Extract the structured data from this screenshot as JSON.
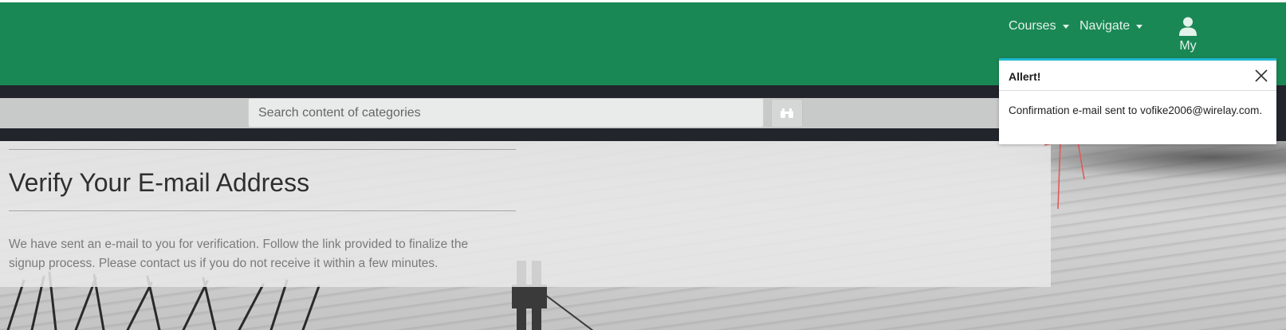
{
  "navbar": {
    "courses_label": "Courses",
    "navigate_label": "Navigate",
    "user_label": "My",
    "background": "#1a8855"
  },
  "search": {
    "placeholder": "Search content of categories",
    "button_icon": "binoculars-icon"
  },
  "main": {
    "title": "Verify Your E-mail Address",
    "body": "We have sent an e-mail to you for verification. Follow the link provided to finalize the signup process. Please contact us if you do not receive it within a few minutes."
  },
  "alert": {
    "title": "Allert!",
    "message": "Confirmation e-mail sent to vofike2006@wirelay.com.",
    "accent": "#1fb8cf"
  }
}
